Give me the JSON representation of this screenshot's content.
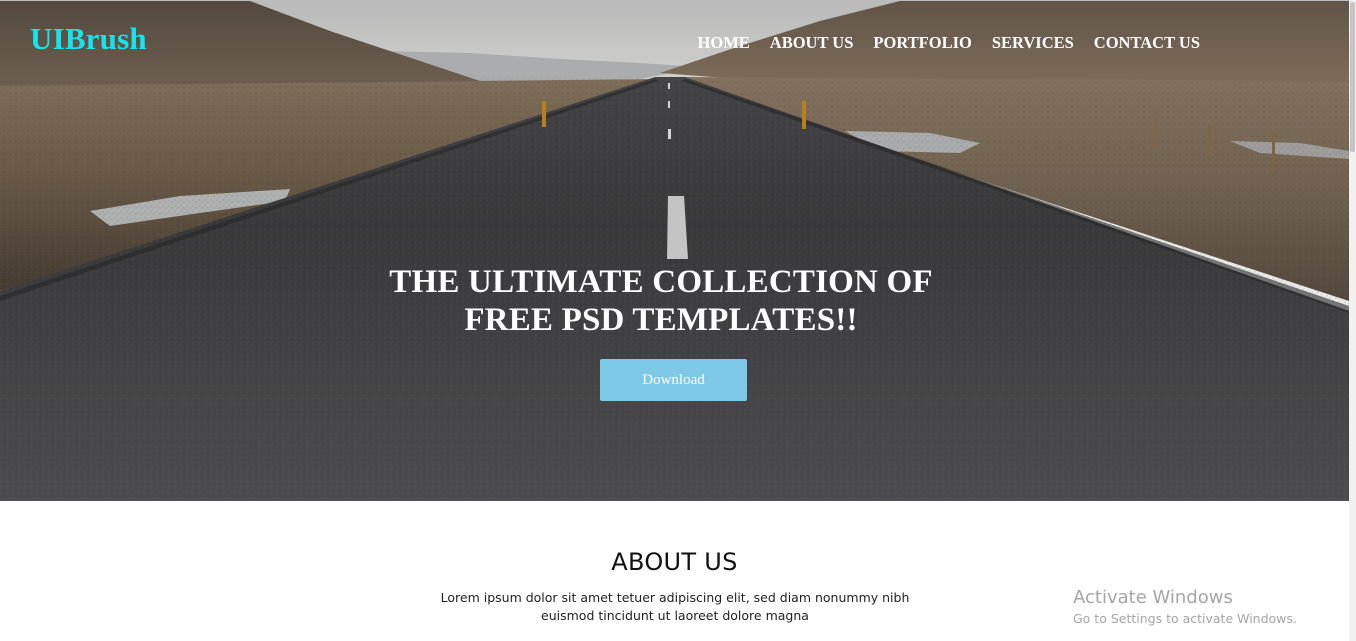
{
  "header": {
    "brand": "UIBrush",
    "nav": [
      {
        "label": "HOME"
      },
      {
        "label": "ABOUT US"
      },
      {
        "label": "PORTFOLIO"
      },
      {
        "label": "SERVICES"
      },
      {
        "label": "CONTACT US"
      }
    ]
  },
  "hero": {
    "title_line1": "THE ULTIMATE COLLECTION OF",
    "title_line2": "FREE PSD TEMPLATES!!",
    "download_label": "Download"
  },
  "about": {
    "title": "ABOUT US",
    "text_line1": "Lorem ipsum dolor sit amet tetuer adipiscing elit, sed diam nonummy nibh",
    "text_line2": "euismod tincidunt ut laoreet dolore magna"
  },
  "watermark": {
    "title": "Activate Windows",
    "subtitle": "Go to Settings to activate Windows."
  },
  "colors": {
    "brand": "#14e4ee",
    "button": "#7ec8e8",
    "nav_text": "#ffffff"
  },
  "icons": {
    "hero_image": "road-landscape-image"
  }
}
